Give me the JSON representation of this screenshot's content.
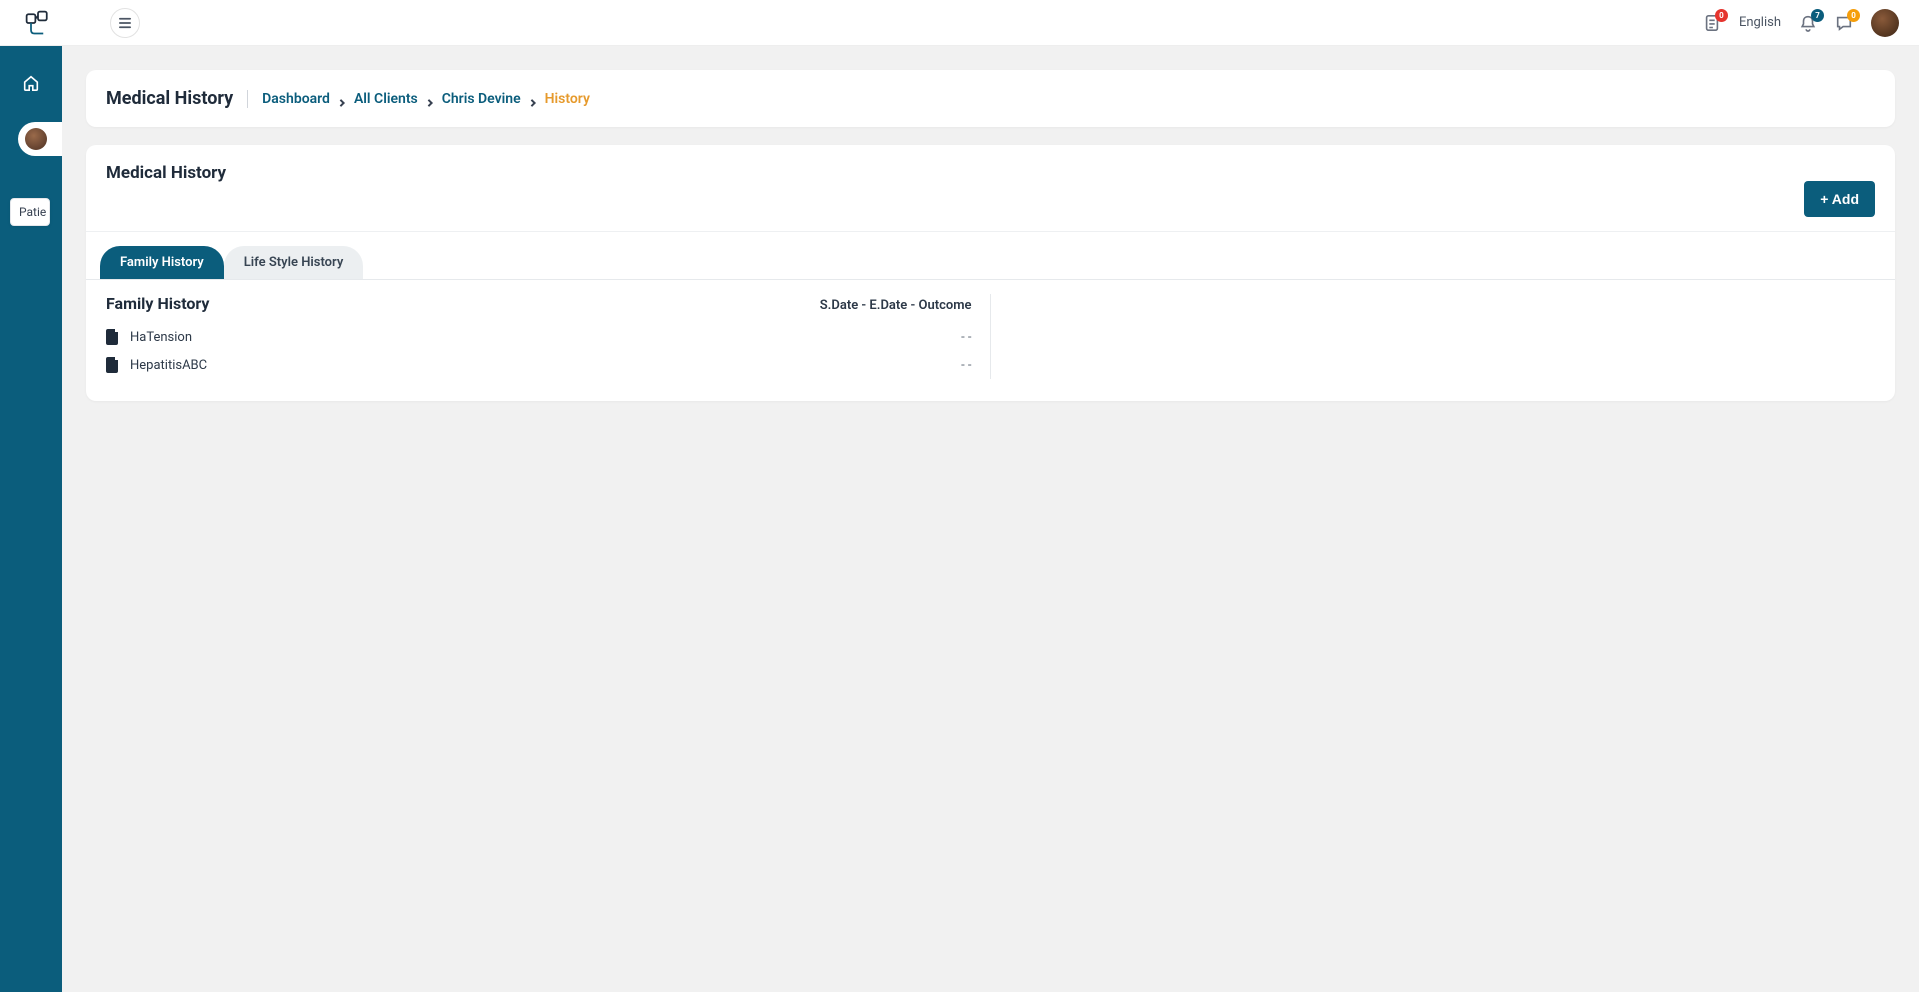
{
  "header": {
    "language": "English",
    "badges": {
      "docs": "0",
      "bell": "7",
      "chat": "0"
    }
  },
  "sidebar": {
    "tooltip": "Patie"
  },
  "breadcrumb": {
    "title": "Medical History",
    "items": [
      {
        "label": "Dashboard",
        "type": "link"
      },
      {
        "label": "All Clients",
        "type": "link"
      },
      {
        "label": "Chris Devine",
        "type": "link"
      },
      {
        "label": "History",
        "type": "active"
      }
    ]
  },
  "section": {
    "title": "Medical History",
    "add_label": "+ Add",
    "tabs": [
      {
        "label": "Family History",
        "active": true
      },
      {
        "label": "Life Style History",
        "active": false
      }
    ],
    "family": {
      "title": "Family History",
      "column_header": "S.Date - E.Date - Outcome",
      "rows": [
        {
          "name": "HaTension",
          "value": "- -"
        },
        {
          "name": "HepatitisABC",
          "value": "- -"
        }
      ]
    }
  }
}
